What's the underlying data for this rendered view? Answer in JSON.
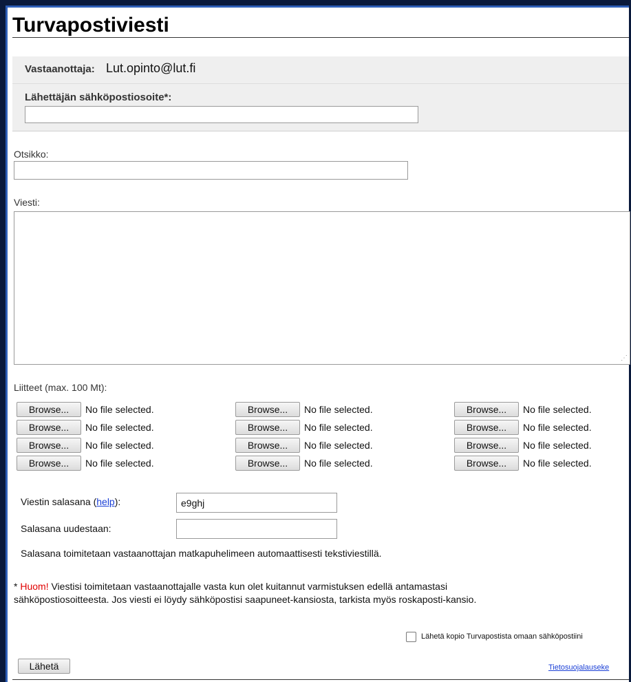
{
  "page": {
    "title": "Turvapostiviesti"
  },
  "recipient": {
    "label": "Vastaanottaja:",
    "value": "Lut.opinto@lut.fi"
  },
  "sender": {
    "label": "Lähettäjän sähköpostiosoite*:",
    "value": ""
  },
  "subject": {
    "label": "Otsikko:",
    "value": ""
  },
  "message": {
    "label": "Viesti:",
    "value": ""
  },
  "attachments": {
    "label": "Liitteet (max. 100 Mt):",
    "browse_label": "Browse...",
    "status_text": "No file selected.",
    "rows": 4,
    "columns": 3
  },
  "password": {
    "label_prefix": "Viestin salasana (",
    "help_link": "help",
    "label_suffix": "):",
    "value": "e9ghj",
    "confirm_label": "Salasana uudestaan:",
    "confirm_value": "",
    "info": "Salasana toimitetaan vastaanottajan matkapuhelimeen automaattisesti tekstiviestillä."
  },
  "note": {
    "asterisk": "* ",
    "huom": "Huom!",
    "text_line1": " Viestisi toimitetaan vastaanottajalle vasta kun olet kuitannut varmistuksen edellä antamastasi",
    "text_line2": "sähköpostiosoitteesta. Jos viesti ei löydy sähköpostisi saapuneet-kansiosta, tarkista myös roskaposti-kansio."
  },
  "copy": {
    "label": "Lähetä kopio Turvapostista omaan sähköpostiini",
    "checked": false
  },
  "footer": {
    "send_label": "Lähetä",
    "privacy_link": "Tietosuojalauseke"
  },
  "colors": {
    "frame": "#0a1a3c",
    "frame_accent": "#2e5fb8",
    "section_bg": "#efefef",
    "link": "#1a3fd6",
    "warning": "#e00000"
  }
}
